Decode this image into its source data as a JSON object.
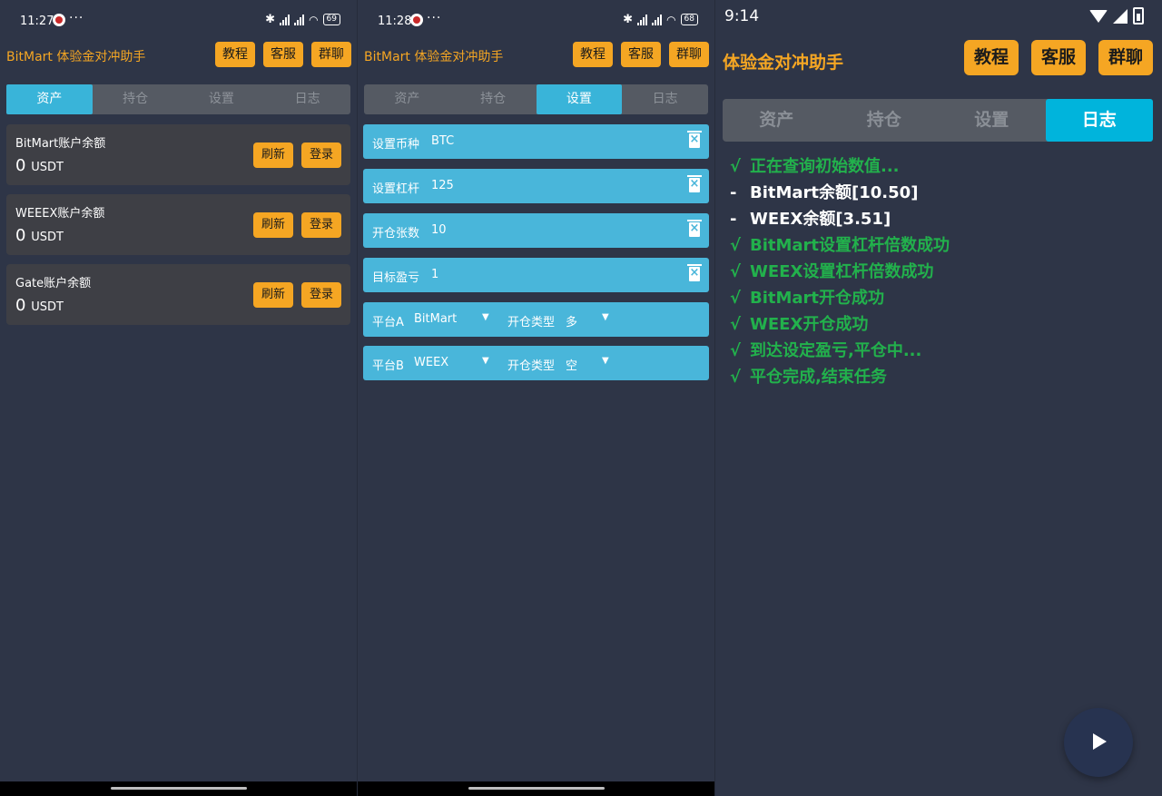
{
  "app_title": "BitMart 体验金对冲助手",
  "app_title_3": "体验金对冲助手",
  "header_buttons": {
    "tutorial": "教程",
    "support": "客服",
    "group": "群聊"
  },
  "tabs": {
    "assets": "资产",
    "positions": "持仓",
    "settings": "设置",
    "log": "日志"
  },
  "status": {
    "time_1": "11:27",
    "time_2": "11:28",
    "time_3": "9:14",
    "dots": "···",
    "battery_1": "69",
    "battery_2": "68"
  },
  "assets": {
    "refresh_label": "刷新",
    "login_label": "登录",
    "accounts": [
      {
        "title": "BitMart账户余额",
        "value": "0",
        "unit": "USDT"
      },
      {
        "title": "WEEEX账户余额",
        "value": "0",
        "unit": "USDT"
      },
      {
        "title": "Gate账户余额",
        "value": "0",
        "unit": "USDT"
      }
    ]
  },
  "settings": {
    "rows": [
      {
        "label": "设置币种",
        "value": "BTC"
      },
      {
        "label": "设置杠杆",
        "value": "125"
      },
      {
        "label": "开仓张数",
        "value": "10"
      },
      {
        "label": "目标盈亏",
        "value": "1"
      }
    ],
    "platform_a": {
      "label": "平台A",
      "value": "BitMart",
      "type_label": "开仓类型",
      "type_value": "多"
    },
    "platform_b": {
      "label": "平台B",
      "value": "WEEX",
      "type_label": "开仓类型",
      "type_value": "空"
    }
  },
  "log": {
    "lines": [
      {
        "mark": "√",
        "text": "正在查询初始数值..."
      },
      {
        "mark": "-",
        "text": "BitMart余额[10.50]"
      },
      {
        "mark": "-",
        "text": "WEEX余额[3.51]"
      },
      {
        "mark": "√",
        "text": "BitMart设置杠杆倍数成功"
      },
      {
        "mark": "√",
        "text": "WEEX设置杠杆倍数成功"
      },
      {
        "mark": "√",
        "text": "BitMart开仓成功"
      },
      {
        "mark": "√",
        "text": "WEEX开仓成功"
      },
      {
        "mark": "√",
        "text": "到达设定盈亏,平仓中..."
      },
      {
        "mark": "√",
        "text": "平仓完成,结束任务"
      }
    ]
  },
  "colors": {
    "accent_orange": "#f5a623",
    "tab_active": "#39b4d9",
    "log_green": "#22b14c",
    "background": "#2e3547"
  }
}
